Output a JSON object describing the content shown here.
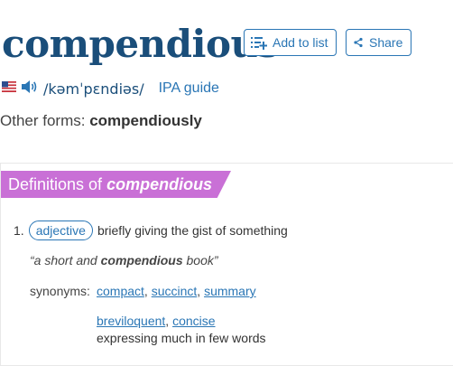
{
  "headword": "compendious",
  "buttons": {
    "add_to_list": "Add to list",
    "share": "Share"
  },
  "pronunciation": {
    "ipa": "/kəmˈpɛndiəs/",
    "ipa_guide": "IPA guide",
    "flag_icon": "us-flag-icon",
    "audio_icon": "speaker-icon"
  },
  "other_forms": {
    "label": "Other forms: ",
    "value": "compendiously"
  },
  "definitions": {
    "header_prefix": "Definitions of ",
    "header_word": "compendious",
    "items": [
      {
        "number": "1.",
        "part_of_speech": "adjective",
        "definition": "briefly giving the gist of something",
        "example": {
          "before": "“a short and ",
          "word": "compendious",
          "after": " book”"
        },
        "synonyms_label": "synonyms:",
        "synonyms": [
          "compact",
          "succinct",
          "summary"
        ],
        "synonyms_group2": [
          "breviloquent",
          "concise"
        ],
        "synonyms_group2_definition": "expressing much in few words"
      }
    ]
  },
  "colors": {
    "headword": "#1a4e7a",
    "link": "#2a76b5",
    "header_bg": "#c970d6"
  }
}
